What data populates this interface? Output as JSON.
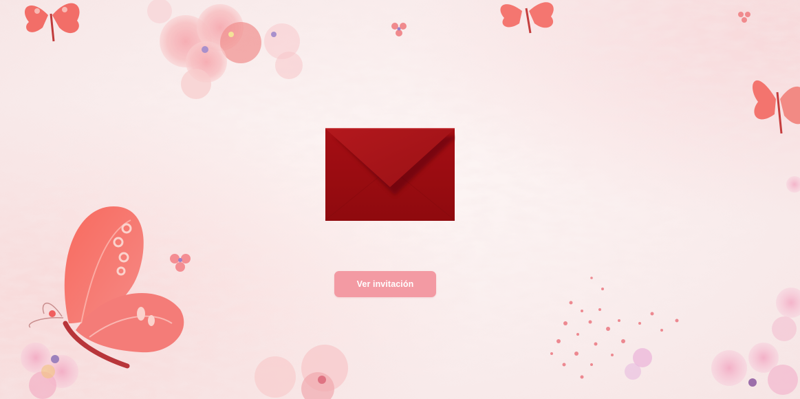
{
  "invitation": {
    "button_label": "Ver invitación",
    "envelope_icon": "envelope-icon",
    "button_color": "#f39aa3",
    "envelope_color": "#a10d12"
  },
  "theme": {
    "background_color": "#fbeeee",
    "decor_icons": [
      "butterfly-icon",
      "flower-icon",
      "watercolor-splatter"
    ]
  }
}
